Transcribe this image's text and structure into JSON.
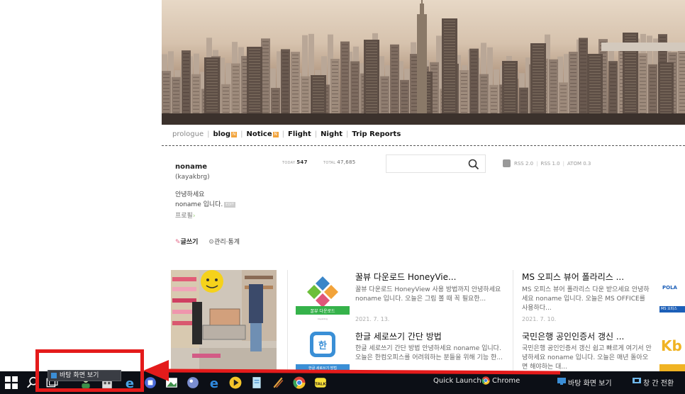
{
  "nav": {
    "items": [
      "prologue",
      "blog",
      "Notice",
      "Flight",
      "Night",
      "Trip Reports"
    ],
    "new_badge": "N"
  },
  "profile": {
    "name": "noname",
    "id": "(kayakbrg)",
    "greeting_line1": "안녕하세요",
    "greeting_line2": "noname 입니다.",
    "edit_badge": "EDIT",
    "profile_link": "프로필",
    "write_link": "글쓰기",
    "manage_link": "관리·통계"
  },
  "stats": {
    "today_label": "TODAY",
    "today_value": "547",
    "total_label": "TOTAL",
    "total_value": "47,685"
  },
  "search": {
    "placeholder": ""
  },
  "feeds": [
    "RSS 2.0",
    "RSS 1.0",
    "ATOM 0.3"
  ],
  "posts": [
    {
      "title": "꿀뷰 다운로드 HoneyVie...",
      "body": "꿀뷰 다운로드 HoneyView 사용 방법까지 안녕하세요 noname 입니다. 오늘은 그림 볼 때 꼭 필요한...",
      "date": "2021. 7. 13.",
      "thumb_label": "꿀뷰 다운로드",
      "thumb_sub": "kayakbrg"
    },
    {
      "title": "MS 오피스 뷰어 폴라리스 ...",
      "body": "MS 오피스 뷰어 폴라리스 다운 받으세요 안녕하세요 noname 입니다. 오늘은 MS OFFICE를 사용하다...",
      "date": "2021. 7. 10."
    },
    {
      "title": "한글 세로쓰기 간단 방법",
      "body": "한글 세로쓰기 간단 방법 안녕하세요 noname 입니다. 오늘은 한컴오피스를 어려워하는 분들을 위해 기능 한...",
      "thumb_label": "한글 세로쓰기 방법"
    },
    {
      "title": "국민은행 공인인증서 갱신 ...",
      "body": "국민은행 공인인증서 갱신 쉽고 빠르게 여기서 안녕하세요 noname 입니다. 오늘은 매년 돌아오면 해야하는 대..."
    }
  ],
  "side_thumbs": {
    "polaris": "POLA",
    "ms": "MS 오피스",
    "kb": "Kb"
  },
  "taskbar": {
    "quick_launch": "Quick Launch",
    "chrome": "Chrome",
    "show_desktop": "바탕 화면 보기",
    "switch_windows": "창 간 전환",
    "tooltip": "바탕 화면 보기"
  },
  "colors": {
    "annotation": "#e41b1b",
    "taskbar": "#0c0f16",
    "badge": "#f2a33a"
  }
}
